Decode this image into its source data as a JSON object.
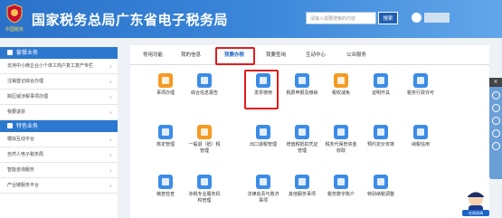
{
  "header": {
    "title": "国家税务总局广东省电子税务局",
    "logo_sub": "中国税务",
    "search_placeholder": "请输入需要搜索的内容",
    "search_label": "搜索"
  },
  "sidebar": {
    "section1": "套餐业务",
    "items1": [
      "支持中小微企业小个体工商户复工复产专栏",
      "注销登记综合办理",
      "跨区域涉税事项办理",
      "我要退票"
    ],
    "section2": "特色业务",
    "items2": [
      "模拟互动平台",
      "自然人电子税务局",
      "智能咨询服务",
      "产业链服务平台"
    ]
  },
  "tabs": [
    "常用功能",
    "我的信息",
    "我要办税",
    "我要查询",
    "互动中心",
    "公众服务"
  ],
  "active_tab": "我要办税",
  "tiles": [
    {
      "label": "事项办理",
      "icon": "pen-icon",
      "color": "#f59a23"
    },
    {
      "label": "综合信息报告",
      "icon": "document-icon",
      "color": "#3c8ce7"
    },
    {
      "label": "发票使用",
      "icon": "invoice-icon",
      "color": "#3c8ce7"
    },
    {
      "label": "税费申报及缴纳",
      "icon": "tax-declare-icon",
      "color": "#3c8ce7"
    },
    {
      "label": "税收减免",
      "icon": "tax-relief-icon",
      "color": "#f59a23"
    },
    {
      "label": "证明开具",
      "icon": "certificate-icon",
      "color": "#3c8ce7"
    },
    {
      "label": "税务行政许可",
      "icon": "admin-license-icon",
      "color": "#3c8ce7"
    },
    {
      "label": "核定管理",
      "icon": "approval-icon",
      "color": "#3c8ce7"
    },
    {
      "label": "一般退（抵）税管理",
      "icon": "refund-icon",
      "color": "#f59a23"
    },
    {
      "label": "出口退税管理",
      "icon": "export-refund-icon",
      "color": "#3c8ce7"
    },
    {
      "label": "增值税抵扣凭证管理",
      "icon": "vat-voucher-icon",
      "color": "#3c8ce7"
    },
    {
      "label": "税务代保管资金收取",
      "icon": "custody-funds-icon",
      "color": "#3c8ce7"
    },
    {
      "label": "预约定价安排",
      "icon": "appointment-icon",
      "color": "#3c8ce7"
    },
    {
      "label": "纳税信用",
      "icon": "credit-icon",
      "color": "#3c8ce7"
    },
    {
      "label": "稽查检查",
      "icon": "inspection-icon",
      "color": "#3c8ce7"
    },
    {
      "label": "涉税专业服务机构管理",
      "icon": "agency-icon",
      "color": "#3c8ce7"
    },
    {
      "label": "法律追责与救济事项",
      "icon": "gavel-icon",
      "color": "#3c8ce7"
    },
    {
      "label": "其他服务事项",
      "icon": "other-service-icon",
      "color": "#3c8ce7"
    },
    {
      "label": "税务数字账户",
      "icon": "digital-account-icon",
      "color": "#3c8ce7"
    },
    {
      "label": "特别纳税调整",
      "icon": "tax-adjust-icon",
      "color": "#3c8ce7"
    }
  ],
  "mascot_label": "在线咨询"
}
